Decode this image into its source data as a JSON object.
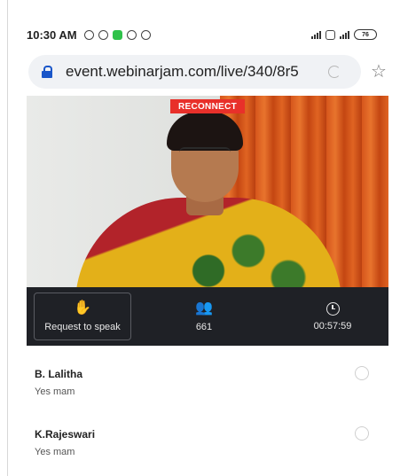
{
  "status_bar": {
    "time": "10:30 AM",
    "battery": "76",
    "icons": [
      "settings-icon",
      "alarm-icon",
      "app-icon",
      "app-icon",
      "whatsapp-icon"
    ]
  },
  "browser": {
    "url": "event.webinarjam.com/live/340/8r5",
    "accent": "#1a56c9"
  },
  "video": {
    "badge": "RECONNECT",
    "badge_color": "#e8302a"
  },
  "controls": {
    "speak_label": "Request to speak",
    "attendees": "661",
    "elapsed": "00:57:59",
    "bar_color": "#1f2126"
  },
  "chat": [
    {
      "name": "B. Lalitha",
      "message": "Yes mam"
    },
    {
      "name": "K.Rajeswari",
      "message": "Yes mam"
    }
  ]
}
